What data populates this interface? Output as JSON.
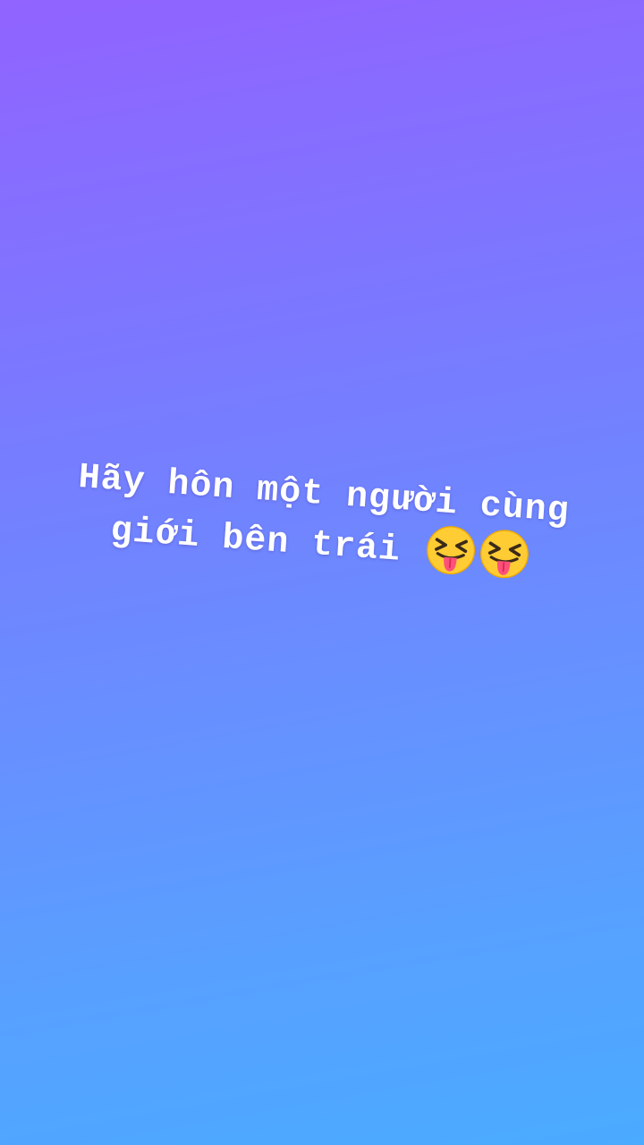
{
  "background": {
    "gradient_start": "#9163ff",
    "gradient_end": "#4aabff"
  },
  "caption": {
    "line1": "Hãy hôn một người cùng",
    "line2": "giới bên trái",
    "color": "#ffffff"
  },
  "emojis": [
    {
      "icon": "squinting-face-with-tongue-icon"
    },
    {
      "icon": "squinting-face-with-tongue-icon"
    }
  ]
}
